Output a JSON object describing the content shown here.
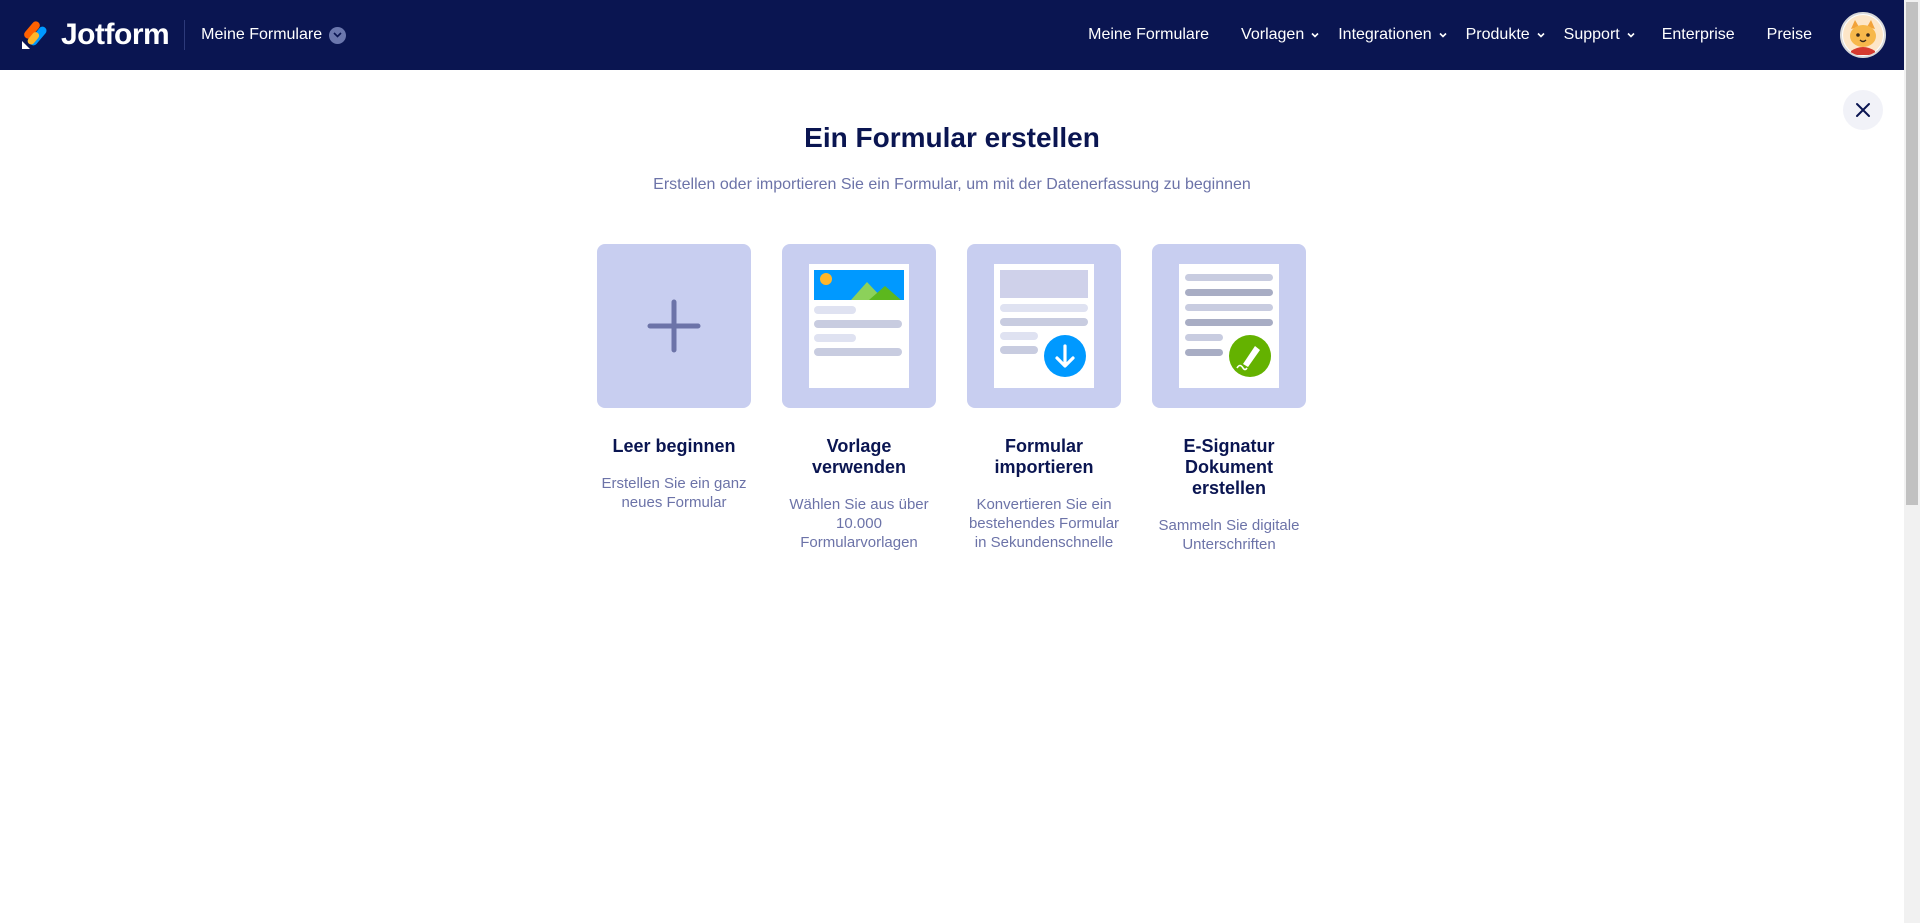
{
  "header": {
    "logo_text": "Jotform",
    "myforms_switch": "Meine Formulare",
    "nav": [
      {
        "label": "Meine Formulare",
        "has_dropdown": false
      },
      {
        "label": "Vorlagen",
        "has_dropdown": true
      },
      {
        "label": "Integrationen",
        "has_dropdown": true
      },
      {
        "label": "Produkte",
        "has_dropdown": true
      },
      {
        "label": "Support",
        "has_dropdown": true
      },
      {
        "label": "Enterprise",
        "has_dropdown": false
      },
      {
        "label": "Preise",
        "has_dropdown": false
      }
    ],
    "avatar_icon": "cat-avatar-icon"
  },
  "main": {
    "title": "Ein Formular erstellen",
    "subtitle": "Erstellen oder importieren Sie ein Formular, um mit der Datenerfassung zu beginnen",
    "close_icon": "close-icon",
    "options": [
      {
        "label": "Leer beginnen",
        "description": "Erstellen Sie ein ganz neues Formular",
        "icon": "plus-icon"
      },
      {
        "label": "Vorlage verwenden",
        "description": "Wählen Sie aus über 10.000 Formularvorlagen",
        "icon": "template-form-icon"
      },
      {
        "label": "Formular importieren",
        "description": "Konvertieren Sie ein bestehendes Formular in Sekundenschnelle",
        "icon": "import-form-icon"
      },
      {
        "label": "E-Signatur Dokument erstellen",
        "description": "Sammeln Sie digitale Unterschriften",
        "icon": "esign-document-icon"
      }
    ]
  },
  "colors": {
    "header_bg": "#0a1551",
    "tile_bg": "#c8cef0",
    "title": "#0a1551",
    "muted_text": "#6c73a8",
    "import_accent": "#0099ff",
    "esign_accent": "#64b200"
  }
}
